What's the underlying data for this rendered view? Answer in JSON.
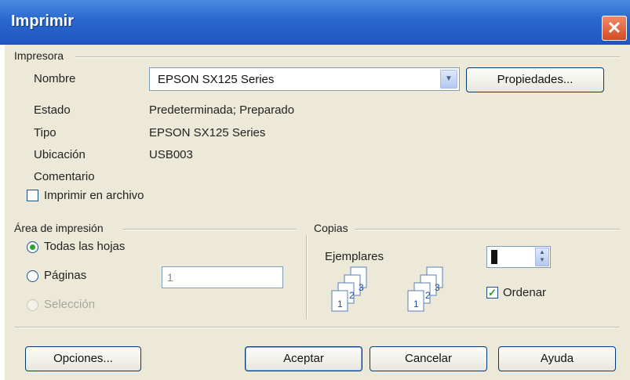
{
  "window": {
    "title": "Imprimir",
    "close_glyph": "✕"
  },
  "printer": {
    "group_label": "Impresora",
    "name_label": "Nombre",
    "name_value": "EPSON SX125 Series",
    "properties_button": "Propiedades...",
    "status_label": "Estado",
    "status_value": "Predeterminada; Preparado",
    "type_label": "Tipo",
    "type_value": "EPSON SX125 Series",
    "location_label": "Ubicación",
    "location_value": "USB003",
    "comment_label": "Comentario",
    "print_to_file_label": "Imprimir en archivo",
    "print_to_file_checked": false
  },
  "print_range": {
    "group_label": "Área de impresión",
    "options": [
      {
        "label": "Todas las hojas",
        "selected": true,
        "enabled": true
      },
      {
        "label": "Páginas",
        "selected": false,
        "enabled": true
      },
      {
        "label": "Selección",
        "selected": false,
        "enabled": false
      }
    ],
    "pages_value": "1"
  },
  "copies": {
    "group_label": "Copias",
    "count_label": "Ejemplares",
    "count_value": "1",
    "collate_label": "Ordenar",
    "collate_checked": true,
    "collate_icon_pages": [
      "1",
      "2",
      "3"
    ]
  },
  "buttons": {
    "options": "Opciones...",
    "ok": "Aceptar",
    "cancel": "Cancelar",
    "help": "Ayuda"
  },
  "icons": {
    "check": "✓",
    "dropdown_arrow": "▼",
    "spin_up": "▲",
    "spin_down": "▼"
  }
}
